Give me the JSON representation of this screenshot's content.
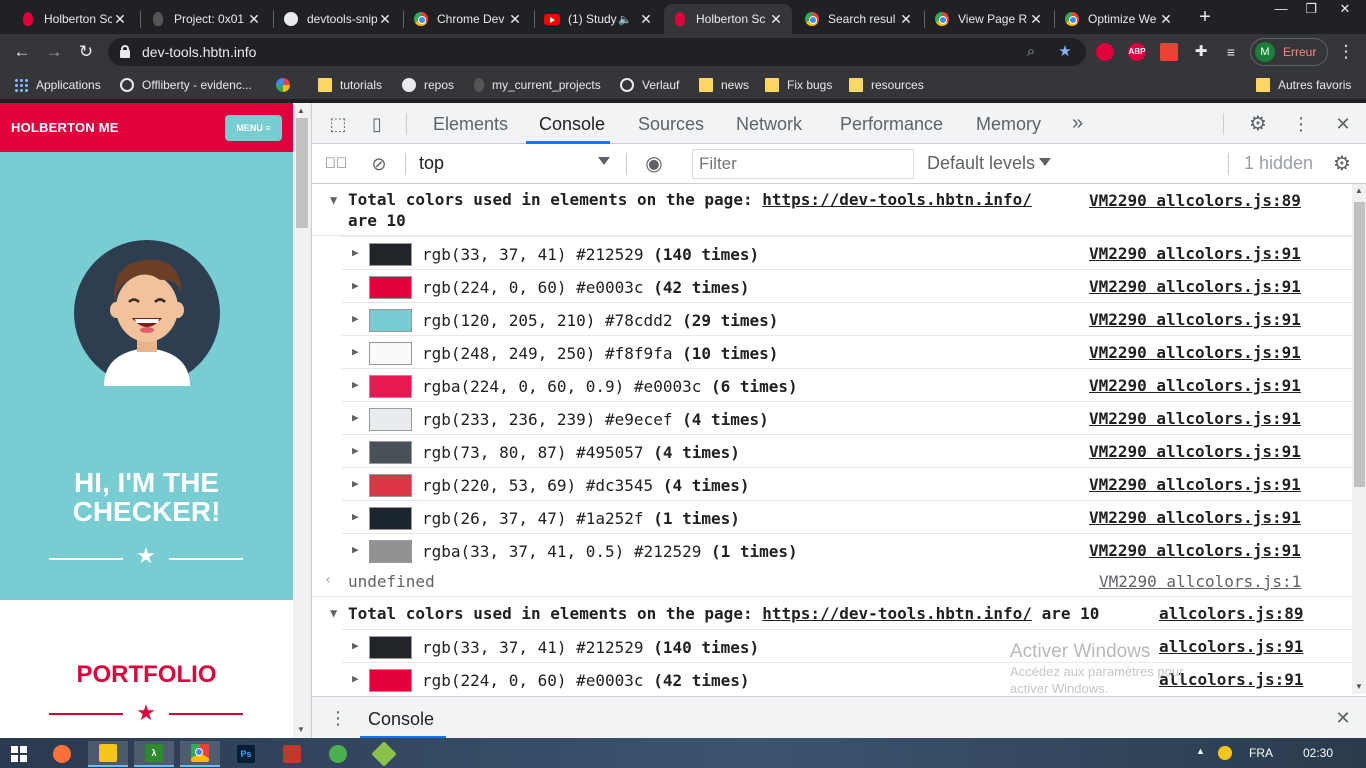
{
  "tabs": [
    {
      "title": "Holberton Sc",
      "favicon": "holberton-icon"
    },
    {
      "title": "Project: 0x01",
      "favicon": "holberton-dark-icon"
    },
    {
      "title": "devtools-snip",
      "favicon": "github-icon"
    },
    {
      "title": "Chrome Dev",
      "favicon": "chrome-icon"
    },
    {
      "title": "(1) Study",
      "favicon": "youtube-icon"
    },
    {
      "title": "Holberton Sc",
      "favicon": "holberton-icon",
      "active": true
    },
    {
      "title": "Search resul",
      "favicon": "chrome-icon"
    },
    {
      "title": "View Page R",
      "favicon": "chrome-icon"
    },
    {
      "title": "Optimize We",
      "favicon": "chrome-icon"
    }
  ],
  "address_bar": {
    "url": "dev-tools.hbtn.info"
  },
  "profile": {
    "initial": "M",
    "status": "Erreur"
  },
  "extensions": {
    "abp": "ABP"
  },
  "bookmarks": [
    {
      "label": "Applications",
      "icon": "apps-grid-icon"
    },
    {
      "label": "Offliberty - evidenc...",
      "icon": "power-icon"
    },
    {
      "label": "",
      "icon": "google-icon"
    },
    {
      "label": "tutorials",
      "icon": "folder-icon"
    },
    {
      "label": "repos",
      "icon": "github-icon"
    },
    {
      "label": "my_current_projects",
      "icon": "holberton-icon"
    },
    {
      "label": "Verlauf",
      "icon": "history-icon"
    },
    {
      "label": "news",
      "icon": "folder-icon"
    },
    {
      "label": "Fix bugs",
      "icon": "folder-icon"
    },
    {
      "label": "resources",
      "icon": "folder-icon"
    }
  ],
  "bookmarks_other": "Autres favoris",
  "site": {
    "brand": "HOLBERTON ME",
    "menu_label": "MENU ≡",
    "hero_title": "HI, I'M THE CHECKER!",
    "section_title": "PORTFOLIO",
    "colors": {
      "primary": "#e0003c",
      "accent": "#78cdd2"
    }
  },
  "devtools": {
    "tabs": [
      "Elements",
      "Console",
      "Sources",
      "Network",
      "Performance",
      "Memory"
    ],
    "active_tab": "Console",
    "more_tabs": "»",
    "context": "top",
    "filter_placeholder": "Filter",
    "levels": "Default levels",
    "hidden_count": "1 hidden",
    "drawer_tab": "Console"
  },
  "console": {
    "group1": {
      "message_prefix": "Total colors used in elements on the page: ",
      "url": "https://dev-tools.hbtn.info/",
      "message_suffix": "are 10",
      "source": "VM2290 allcolors.js:89"
    },
    "rows": [
      {
        "color": "#212529",
        "text": "rgb(33, 37, 41) #212529 ",
        "count": "(140 times)",
        "source": "VM2290 allcolors.js:91"
      },
      {
        "color": "#e0003c",
        "text": "rgb(224, 0, 60) #e0003c ",
        "count": "(42 times)",
        "source": "VM2290 allcolors.js:91"
      },
      {
        "color": "#78cdd2",
        "text": "rgb(120, 205, 210) #78cdd2 ",
        "count": "(29 times)",
        "source": "VM2290 allcolors.js:91"
      },
      {
        "color": "#f8f9fa",
        "text": "rgb(248, 249, 250) #f8f9fa ",
        "count": "(10 times)",
        "source": "VM2290 allcolors.js:91"
      },
      {
        "color": "#e61a50",
        "text": "rgba(224, 0, 60, 0.9) #e0003c ",
        "count": "(6 times)",
        "source": "VM2290 allcolors.js:91"
      },
      {
        "color": "#e9ecef",
        "text": "rgb(233, 236, 239) #e9ecef ",
        "count": "(4 times)",
        "source": "VM2290 allcolors.js:91"
      },
      {
        "color": "#495057",
        "text": "rgb(73, 80, 87) #495057 ",
        "count": "(4 times)",
        "source": "VM2290 allcolors.js:91"
      },
      {
        "color": "#dc3545",
        "text": "rgb(220, 53, 69) #dc3545 ",
        "count": "(4 times)",
        "source": "VM2290 allcolors.js:91"
      },
      {
        "color": "#1a252f",
        "text": "rgb(26, 37, 47) #1a252f ",
        "count": "(1 times)",
        "source": "VM2290 allcolors.js:91"
      },
      {
        "color": "#909294",
        "text": "rgba(33, 37, 41, 0.5) #212529 ",
        "count": "(1 times)",
        "source": "VM2290 allcolors.js:91"
      }
    ],
    "return_value": "undefined",
    "return_source": "VM2290 allcolors.js:1",
    "group2": {
      "message_prefix": "Total colors used in elements on the page: ",
      "url": "https://dev-tools.hbtn.info/",
      "message_suffix": " are 10",
      "source": "allcolors.js:89"
    },
    "rows2": [
      {
        "color": "#212529",
        "text": "rgb(33, 37, 41) #212529 ",
        "count": "(140 times)",
        "source": "allcolors.js:91"
      },
      {
        "color": "#e0003c",
        "text": "rgb(224, 0, 60) #e0003c ",
        "count": "(42 times)",
        "source": "allcolors.js:91"
      }
    ]
  },
  "watermark": {
    "title": "Activer Windows",
    "line1": "Accédez aux paramètres pour",
    "line2": "activer Windows."
  },
  "taskbar": {
    "language": "FRA",
    "time": "02:30"
  }
}
